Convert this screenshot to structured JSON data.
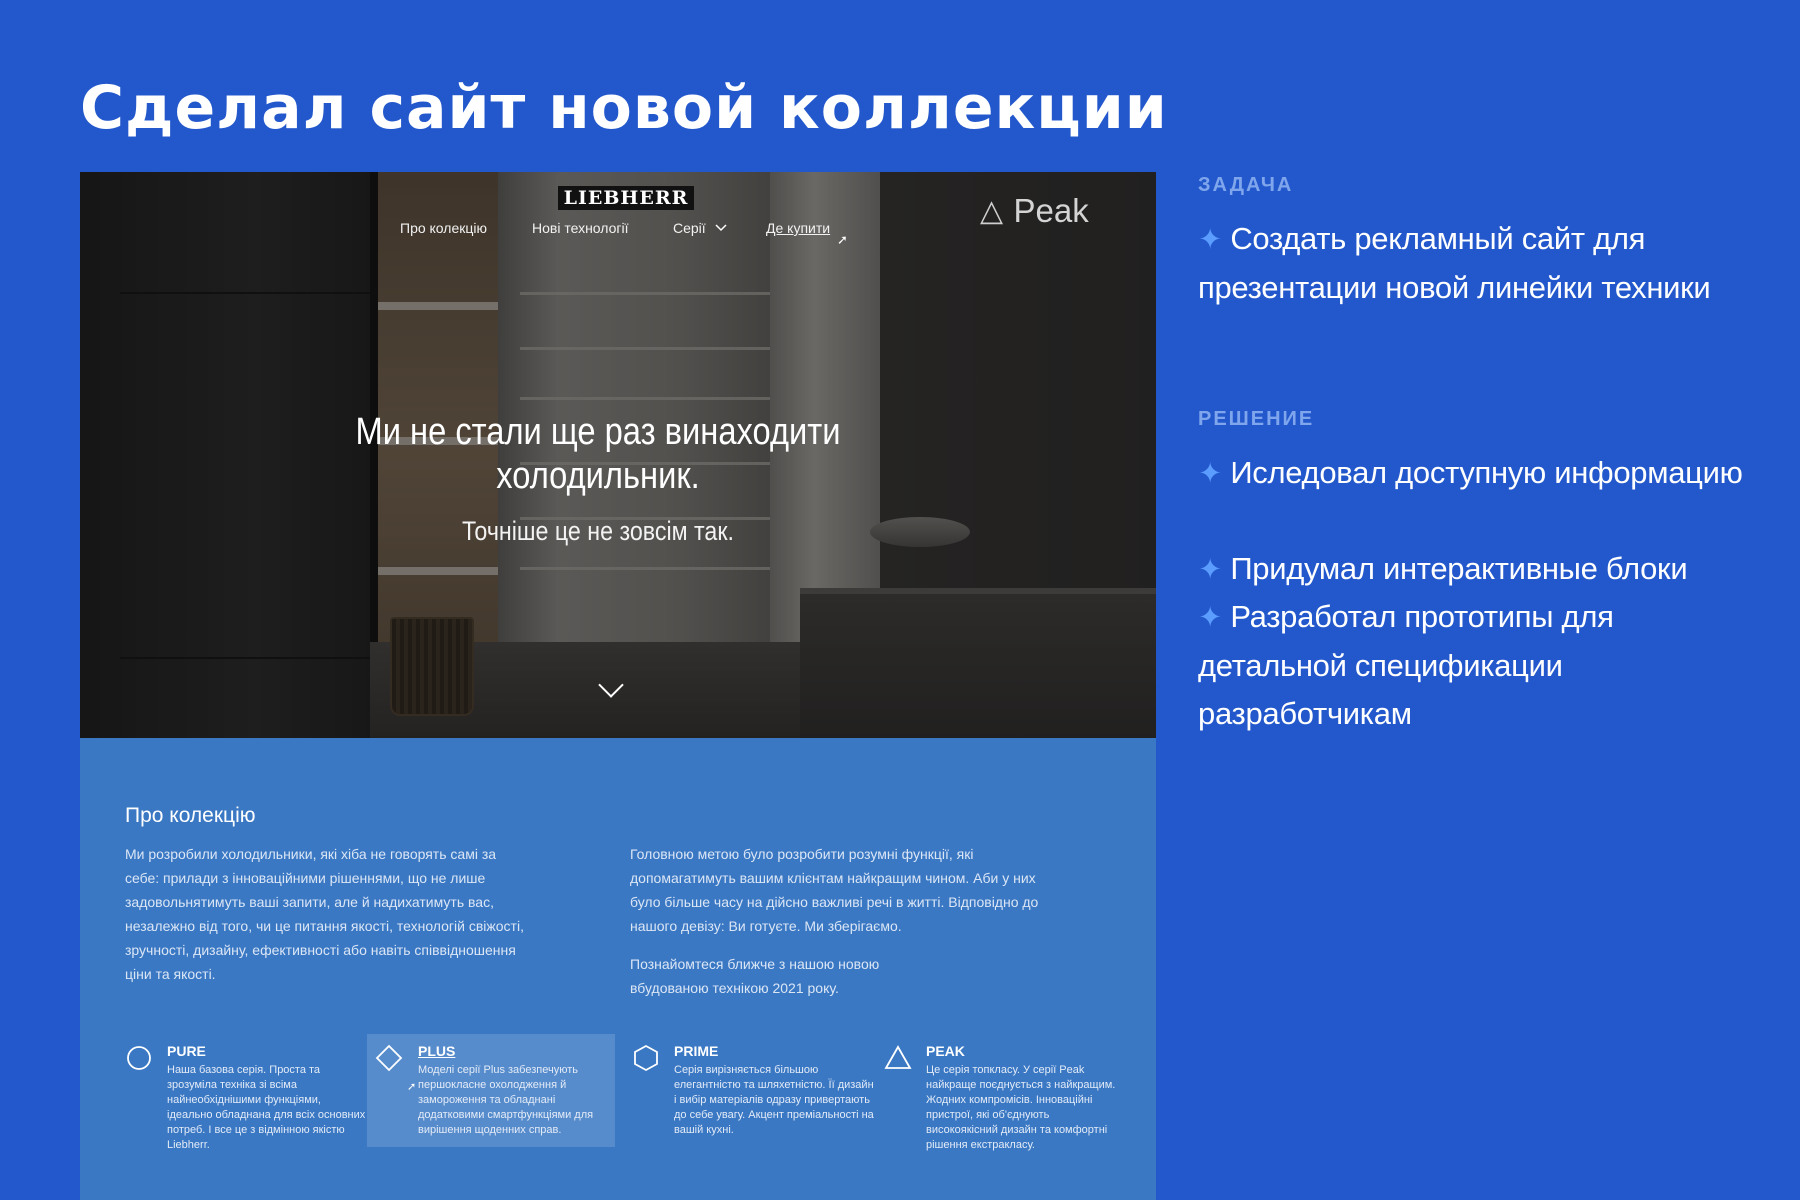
{
  "page_title": "Сделал сайт новой коллекции",
  "site": {
    "logo": "LIEBHERR",
    "nav": [
      {
        "label": "Про колекцію"
      },
      {
        "label": "Нові технології"
      },
      {
        "label": "Серії"
      },
      {
        "label": "Де купити"
      }
    ],
    "brand": {
      "icon": "triangle-icon",
      "name": "Peak"
    },
    "hero": {
      "headline": "Ми не стали ще раз винаходити холодильник.",
      "subheadline": "Точніше це не зовсім так."
    },
    "about": {
      "title": "Про колекцію",
      "left_text": "Ми розробили холодильники, які хіба не говорять самі за себе: прилади з інноваційними рішеннями, що не лише задовольнятимуть ваші запити, але й надихатимуть вас, незалежно від того, чи це питання якості, технологій свіжості, зручності, дизайну, ефективності або навіть співвідношення ціни та якості.",
      "right_text_1": "Головною метою було розробити розумні функції, які допомагатимуть вашим клієнтам найкращим чином. Аби у них було більше часу на дійсно важливі речі в житті. Відповідно до нашого девізу: Ви готуєте. Ми зберігаємо.",
      "right_text_2": "Познайомтеся ближче з нашою новою вбудованою технікою 2021 року."
    },
    "series": [
      {
        "name": "PURE",
        "icon": "circle-icon",
        "desc": "Наша базова серія. Проста та зрозуміла техніка зі всіма найнеобхіднішими функціями, ідеально обладнана для всіх основних потреб. І все це з відмінною якістю Liebherr."
      },
      {
        "name": "PLUS",
        "icon": "diamond-icon",
        "desc": "Моделі серії Plus забезпечують першокласне охолодження й замороження та обладнані додатковими смартфункціями для вирішення щоденних справ."
      },
      {
        "name": "PRIME",
        "icon": "hexagon-icon",
        "desc": "Серія вирізняється більшою елегантністю та шляхетністю. Її дизайн і вибір матеріалів одразу привертають до себе увагу. Акцент преміальності на вашій кухні."
      },
      {
        "name": "PEAK",
        "icon": "triangle-icon",
        "desc": "Це серія топкласу. У серії Peak найкраще поєднується з найкращим. Жодних компромісів. Інноваційні пристрої, які об'єднують високоякісний дизайн та комфортні рішення екстракласу."
      }
    ]
  },
  "side": {
    "task_label": "ЗАДАЧА",
    "task_text": "Создать рекламный сайт для презентации новой линейки техники",
    "solution_label": "РЕШЕНИЕ",
    "solution_items": [
      "Иследовал доступную информацию",
      "Придумал интерактивные блоки",
      "Разработал прототипы для детальной спецификации разработчикам"
    ],
    "bullet_icon": "sparkle-icon",
    "bullet_color": "#5b9cff"
  },
  "colors": {
    "background": "#2358cc",
    "about_block": "#3a78c4",
    "label_color": "#7fa6ec"
  }
}
